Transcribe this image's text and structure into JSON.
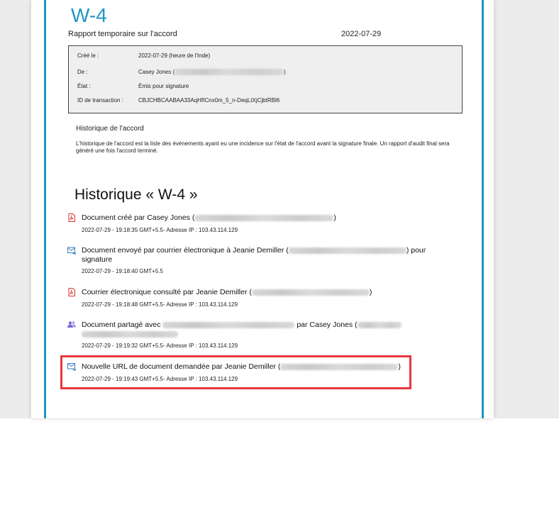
{
  "document": {
    "title": "W-4",
    "subtitle": "Rapport temporaire sur l'accord",
    "date": "2022-07-29"
  },
  "info": {
    "rows": [
      {
        "key": "Créé le :",
        "value": "2022-07-29 (heure de l'Inde)"
      },
      {
        "key": "De :",
        "value": "Casey Jones (",
        "suffix": ")"
      },
      {
        "key": "État :",
        "value": "Émis pour signature"
      },
      {
        "key": "ID de transaction :",
        "value": "CBJCHBCAABAA33AqHfICnx0m_5_n-DeqLtXjCjbtRBl6"
      }
    ]
  },
  "section": {
    "heading": "Historique de l'accord",
    "text": "L'historique de l'accord est la liste des événements ayant eu une incidence sur l'état de l'accord avant la signature finale. Un rapport d'audit final sera généré une fois l'accord terminé."
  },
  "history": {
    "heading": "Historique « W-4 »",
    "events": [
      {
        "icon": "pdf-document-icon",
        "text_before": "Document créé par Casey Jones (",
        "text_after": ")",
        "meta": "2022-07-29 - 19:18:35 GMT+5.5- Adresse IP : 103.43.114.129"
      },
      {
        "icon": "email-sent-icon",
        "text_before": "Document envoyé par courrier électronique à Jeanie Demiller (",
        "text_after": ") pour signature",
        "meta": "2022-07-29 - 19:18:40 GMT+5.5"
      },
      {
        "icon": "pdf-document-icon",
        "text_before": "Courrier électronique consulté par Jeanie Demiller (",
        "text_after": ")",
        "meta": "2022-07-29 - 19:18:48 GMT+5.5- Adresse IP : 103.43.114.129"
      },
      {
        "icon": "users-share-icon",
        "text_before": "Document partagé avec",
        "text_middle": "par Casey Jones (",
        "text_after": "",
        "meta": "2022-07-29 - 19:19:32 GMT+5.5- Adresse IP : 103.43.114.129"
      },
      {
        "icon": "email-link-icon",
        "text_before": "Nouvelle URL de document demandée par Jeanie Demiller (",
        "text_after": ")",
        "meta": "2022-07-29 - 19:19:43 GMT+5.5- Adresse IP : 103.43.114.129"
      }
    ]
  },
  "colors": {
    "accent": "#1f95c3",
    "highlight": "#e8373f",
    "pdf_icon": "#d9302c",
    "mail_icon": "#3a7fc1",
    "users_icon": "#7d6ad1"
  }
}
